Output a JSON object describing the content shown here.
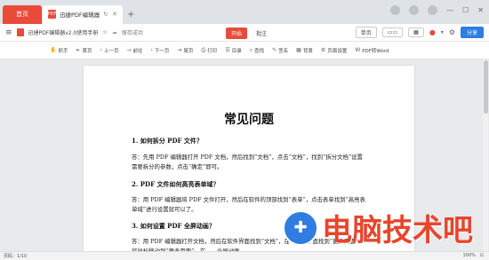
{
  "tabs": {
    "home_label": "首页",
    "doc_label": "迅捷PDF编辑器",
    "pdf_icon": "PDF",
    "refresh_icon": "↻",
    "close_icon": "✕",
    "add_icon": "+"
  },
  "window": {
    "minimize": "—",
    "maximize": "☐",
    "close": "✕"
  },
  "menubar": {
    "hamburger": "≡",
    "doc_name": "迅捷PDF编辑器v2.0使用手册",
    "star": "☆",
    "save_status": "保存成功",
    "start": "开始",
    "annotate": "批注",
    "single_page": "单页",
    "share": "分享"
  },
  "toolbar": {
    "items": [
      "抓手",
      "首页",
      "上一页",
      "前往",
      "下一页",
      "尾页",
      "打印",
      "目录",
      "查找",
      "签名",
      "背景",
      "页面设置",
      "PDF转Word"
    ],
    "icons": [
      "✋",
      "⇤",
      "‹",
      "→",
      "›",
      "⇥",
      "⎙",
      "☰",
      "⌕",
      "✎",
      "▦",
      "⚙",
      "W"
    ]
  },
  "document": {
    "title": "常见问题",
    "q1": "1.  如何拆分 PDF 文件？",
    "a1": "答：先用 PDF 编辑器打开 PDF 文档，然后找到“文档”，点击“文档”，找到“拆分文档”设置需要拆分的参数，点击“确定”即可。",
    "q2": "2.  PDF 文件如何高亮表单域？",
    "a2": "答：用 PDF 编辑器将 PDF 文件打开，然后在软件的顶部找到“表单”，点击表单找到“高亮表单域”进行设置就可以了。",
    "q3": "3.  如何设置 PDF 全屏动画？",
    "a3": "答：用 PDF 编辑器打开文档，然后在软件界面找到“文档”，在“文档”下面找到“更多页面”，将鼠标移动到“更多页面”，在……全屏动画……"
  },
  "statusbar": {
    "page_info": "页码：1/10",
    "zoom": "100%",
    "fit": "⊡"
  },
  "watermark": {
    "text": "电脑技术吧",
    "logo_glyph": "✚"
  }
}
